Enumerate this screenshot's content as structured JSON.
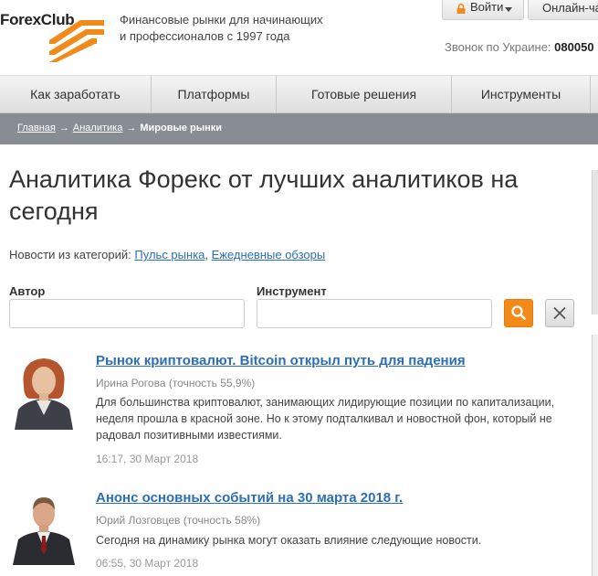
{
  "header": {
    "logo_text": "ForexClub",
    "tagline_line1": "Финансовые рынки для начинающих",
    "tagline_line2": "и профессионалов с 1997 года",
    "login_label": "Войти",
    "chat_label": "Онлайн-чат",
    "phone_label": "Звонок по Украине:",
    "phone_number": "080050",
    "brand_color": "#f28a1a"
  },
  "nav": {
    "items": [
      {
        "label": "Как заработать"
      },
      {
        "label": "Платформы"
      },
      {
        "label": "Готовые решения"
      },
      {
        "label": "Инструменты"
      }
    ]
  },
  "breadcrumb": {
    "home": "Главная",
    "analytics": "Аналитика",
    "current": "Мировые рынки",
    "separator": "→"
  },
  "main": {
    "title": "Аналитика Форекс от лучших аналитиков на сегодня",
    "categories_prefix": "Новости из категорий:",
    "category_1": "Пульс рынка",
    "category_2": "Ежедневные обзоры",
    "author_label": "Автор",
    "instrument_label": "Инструмент",
    "author_value": "",
    "instrument_value": ""
  },
  "articles": [
    {
      "title": "Рынок криптовалют. Bitcoin открыл путь для падения",
      "author": "Ирина Рогова (точность 55,9%)",
      "text": "Для большинства криптовалют, занимающих лидирующие позиции по капитализации, неделя прошла в красной зоне.  Но к этому подталкивал и новостной фон, который не радовал позитивными известиями.",
      "date": "16:17, 30 Март 2018"
    },
    {
      "title": "Анонс основных событий на 30 марта 2018 г.",
      "author": "Юрий Лозговцев (точность 58%)",
      "text": "Сегодня на динамику рынка могут оказать влияние следующие новости.",
      "date": "06:55, 30 Март 2018"
    }
  ]
}
